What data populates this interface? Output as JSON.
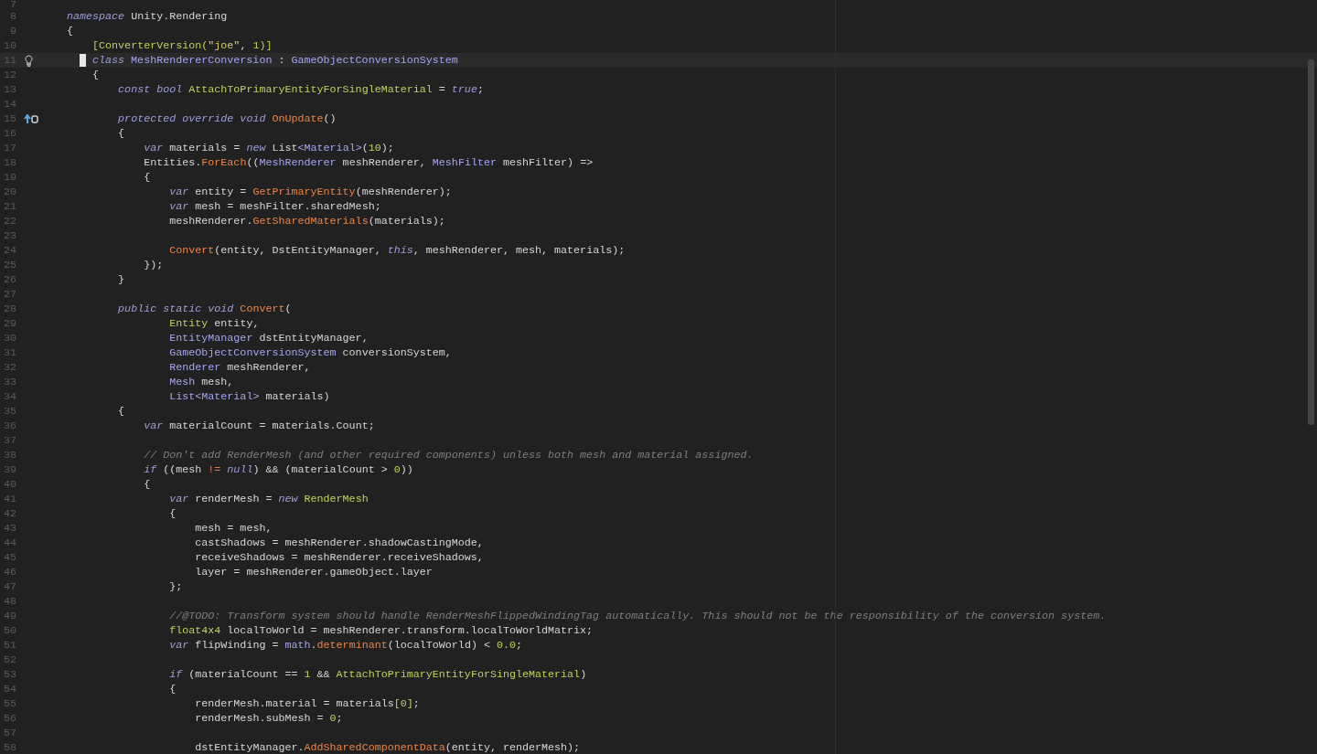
{
  "editor": {
    "lines": [
      {
        "number": "7",
        "kind": "code",
        "current": false
      },
      {
        "number": "8",
        "kind": "code",
        "current": false,
        "tokens": [
          {
            "text": "namespace",
            "kind": "kw"
          },
          {
            "text": " Unity.Rendering",
            "kind": "t"
          }
        ]
      },
      {
        "number": "9",
        "kind": "code",
        "current": false,
        "tokens": [
          {
            "text": "{",
            "kind": "t"
          }
        ]
      },
      {
        "number": "10",
        "kind": "code",
        "current": false,
        "tokens": [
          {
            "text": "    [ConverterVersion(",
            "kind": "cls"
          },
          {
            "text": "\"joe\"",
            "kind": "str"
          },
          {
            "text": ", ",
            "kind": "t"
          },
          {
            "text": "1",
            "kind": "num"
          },
          {
            "text": ")]",
            "kind": "cls"
          }
        ]
      },
      {
        "number": "11",
        "kind": "bulb",
        "current": true,
        "tokens": [
          {
            "text": " class",
            "kind": "kw"
          },
          {
            "text": " MeshRendererConversion",
            "kind": "type"
          },
          {
            "text": " : ",
            "kind": "t"
          },
          {
            "text": "GameObjectConversionSystem",
            "kind": "type"
          }
        ]
      },
      {
        "number": "12",
        "kind": "code",
        "current": false,
        "tokens": [
          {
            "text": "    {",
            "kind": "t"
          }
        ]
      },
      {
        "number": "13",
        "kind": "code",
        "current": false,
        "tokens": [
          {
            "text": "        const bool",
            "kind": "kw"
          },
          {
            "text": " AttachToPrimaryEntityForSingleMaterial",
            "kind": "cls"
          },
          {
            "text": " = ",
            "kind": "t"
          },
          {
            "text": "true",
            "kind": "kw"
          },
          {
            "text": ";",
            "kind": "t"
          }
        ]
      },
      {
        "number": "14",
        "kind": "code",
        "current": false
      },
      {
        "number": "15",
        "kind": "override",
        "current": false,
        "tokens": [
          {
            "text": "        protected override void",
            "kind": "kw"
          },
          {
            "text": " OnUpdate",
            "kind": "fn"
          },
          {
            "text": "()",
            "kind": "t"
          }
        ]
      },
      {
        "number": "16",
        "kind": "code",
        "current": false,
        "tokens": [
          {
            "text": "        {",
            "kind": "t"
          }
        ]
      },
      {
        "number": "17",
        "kind": "code",
        "current": false,
        "tokens": [
          {
            "text": "            var",
            "kind": "kw"
          },
          {
            "text": " materials = ",
            "kind": "t"
          },
          {
            "text": "new",
            "kind": "kw"
          },
          {
            "text": " List",
            "kind": "t"
          },
          {
            "text": "<Material>",
            "kind": "type"
          },
          {
            "text": "(",
            "kind": "t"
          },
          {
            "text": "10",
            "kind": "num"
          },
          {
            "text": ");",
            "kind": "t"
          }
        ]
      },
      {
        "number": "18",
        "kind": "code",
        "current": false,
        "tokens": [
          {
            "text": "            Entities.",
            "kind": "t"
          },
          {
            "text": "ForEach",
            "kind": "fn"
          },
          {
            "text": "((",
            "kind": "t"
          },
          {
            "text": "MeshRenderer",
            "kind": "type"
          },
          {
            "text": " meshRenderer, ",
            "kind": "t"
          },
          {
            "text": "MeshFilter",
            "kind": "type"
          },
          {
            "text": " meshFilter) =>",
            "kind": "t"
          }
        ]
      },
      {
        "number": "19",
        "kind": "code",
        "current": false,
        "tokens": [
          {
            "text": "            {",
            "kind": "t"
          }
        ]
      },
      {
        "number": "20",
        "kind": "code",
        "current": false,
        "tokens": [
          {
            "text": "                var",
            "kind": "kw"
          },
          {
            "text": " entity = ",
            "kind": "t"
          },
          {
            "text": "GetPrimaryEntity",
            "kind": "fn"
          },
          {
            "text": "(meshRenderer);",
            "kind": "t"
          }
        ]
      },
      {
        "number": "21",
        "kind": "code",
        "current": false,
        "tokens": [
          {
            "text": "                var",
            "kind": "kw"
          },
          {
            "text": " mesh = meshFilter.sharedMesh;",
            "kind": "t"
          }
        ]
      },
      {
        "number": "22",
        "kind": "code",
        "current": false,
        "tokens": [
          {
            "text": "                meshRenderer.",
            "kind": "t"
          },
          {
            "text": "GetSharedMaterials",
            "kind": "fn"
          },
          {
            "text": "(materials);",
            "kind": "t"
          }
        ]
      },
      {
        "number": "23",
        "kind": "code",
        "current": false
      },
      {
        "number": "24",
        "kind": "code",
        "current": false,
        "tokens": [
          {
            "text": "                Convert",
            "kind": "fn"
          },
          {
            "text": "(entity, DstEntityManager, ",
            "kind": "t"
          },
          {
            "text": "this",
            "kind": "kw"
          },
          {
            "text": ", meshRenderer, mesh, materials);",
            "kind": "t"
          }
        ]
      },
      {
        "number": "25",
        "kind": "code",
        "current": false,
        "tokens": [
          {
            "text": "            });",
            "kind": "t"
          }
        ]
      },
      {
        "number": "26",
        "kind": "code",
        "current": false,
        "tokens": [
          {
            "text": "        }",
            "kind": "t"
          }
        ]
      },
      {
        "number": "27",
        "kind": "code",
        "current": false
      },
      {
        "number": "28",
        "kind": "code",
        "current": false,
        "tokens": [
          {
            "text": "        public static void",
            "kind": "kw"
          },
          {
            "text": " Convert",
            "kind": "fn"
          },
          {
            "text": "(",
            "kind": "t"
          }
        ]
      },
      {
        "number": "29",
        "kind": "code",
        "current": false,
        "tokens": [
          {
            "text": "                Entity",
            "kind": "cls"
          },
          {
            "text": " entity,",
            "kind": "t"
          }
        ]
      },
      {
        "number": "30",
        "kind": "code",
        "current": false,
        "tokens": [
          {
            "text": "                EntityManager",
            "kind": "type"
          },
          {
            "text": " dstEntityManager,",
            "kind": "t"
          }
        ]
      },
      {
        "number": "31",
        "kind": "code",
        "current": false,
        "tokens": [
          {
            "text": "                GameObjectConversionSystem",
            "kind": "type"
          },
          {
            "text": " conversionSystem,",
            "kind": "t"
          }
        ]
      },
      {
        "number": "32",
        "kind": "code",
        "current": false,
        "tokens": [
          {
            "text": "                Renderer",
            "kind": "type"
          },
          {
            "text": " meshRenderer,",
            "kind": "t"
          }
        ]
      },
      {
        "number": "33",
        "kind": "code",
        "current": false,
        "tokens": [
          {
            "text": "                Mesh",
            "kind": "type"
          },
          {
            "text": " mesh,",
            "kind": "t"
          }
        ]
      },
      {
        "number": "34",
        "kind": "code",
        "current": false,
        "tokens": [
          {
            "text": "                List<Material>",
            "kind": "type"
          },
          {
            "text": " materials)",
            "kind": "t"
          }
        ]
      },
      {
        "number": "35",
        "kind": "code",
        "current": false,
        "tokens": [
          {
            "text": "        {",
            "kind": "t"
          }
        ]
      },
      {
        "number": "36",
        "kind": "code",
        "current": false,
        "tokens": [
          {
            "text": "            var",
            "kind": "kw"
          },
          {
            "text": " materialCount = materials.Count;",
            "kind": "t"
          }
        ]
      },
      {
        "number": "37",
        "kind": "code",
        "current": false
      },
      {
        "number": "38",
        "kind": "code",
        "current": false,
        "tokens": [
          {
            "text": "            // Don't add RenderMesh (and other required components) unless both mesh and material assigned.",
            "kind": "cm"
          }
        ]
      },
      {
        "number": "39",
        "kind": "code",
        "current": false,
        "tokens": [
          {
            "text": "            if",
            "kind": "kw"
          },
          {
            "text": " ((mesh ",
            "kind": "t"
          },
          {
            "text": "!=",
            "kind": "op"
          },
          {
            "text": " null",
            "kind": "kw"
          },
          {
            "text": ") && (materialCount > ",
            "kind": "t"
          },
          {
            "text": "0",
            "kind": "num"
          },
          {
            "text": "))",
            "kind": "t"
          }
        ]
      },
      {
        "number": "40",
        "kind": "code",
        "current": false,
        "tokens": [
          {
            "text": "            {",
            "kind": "t"
          }
        ]
      },
      {
        "number": "41",
        "kind": "code",
        "current": false,
        "tokens": [
          {
            "text": "                var",
            "kind": "kw"
          },
          {
            "text": " renderMesh = ",
            "kind": "t"
          },
          {
            "text": "new",
            "kind": "kw"
          },
          {
            "text": " RenderMesh",
            "kind": "cls"
          }
        ]
      },
      {
        "number": "42",
        "kind": "code",
        "current": false,
        "tokens": [
          {
            "text": "                {",
            "kind": "t"
          }
        ]
      },
      {
        "number": "43",
        "kind": "code",
        "current": false,
        "tokens": [
          {
            "text": "                    mesh = mesh,",
            "kind": "t"
          }
        ]
      },
      {
        "number": "44",
        "kind": "code",
        "current": false,
        "tokens": [
          {
            "text": "                    castShadows = meshRenderer.shadowCastingMode,",
            "kind": "t"
          }
        ]
      },
      {
        "number": "45",
        "kind": "code",
        "current": false,
        "tokens": [
          {
            "text": "                    receiveShadows = meshRenderer.receiveShadows,",
            "kind": "t"
          }
        ]
      },
      {
        "number": "46",
        "kind": "code",
        "current": false,
        "tokens": [
          {
            "text": "                    layer = meshRenderer.gameObject.layer",
            "kind": "t"
          }
        ]
      },
      {
        "number": "47",
        "kind": "code",
        "current": false,
        "tokens": [
          {
            "text": "                };",
            "kind": "t"
          }
        ]
      },
      {
        "number": "48",
        "kind": "code",
        "current": false
      },
      {
        "number": "49",
        "kind": "code",
        "current": false,
        "tokens": [
          {
            "text": "                //@TODO: Transform system should handle RenderMeshFlippedWindingTag automatically. This should not be the responsibility of the conversion system.",
            "kind": "cm"
          }
        ]
      },
      {
        "number": "50",
        "kind": "code",
        "current": false,
        "tokens": [
          {
            "text": "                float4x4",
            "kind": "cls"
          },
          {
            "text": " localToWorld = meshRenderer.transform.localToWorldMatrix;",
            "kind": "t"
          }
        ]
      },
      {
        "number": "51",
        "kind": "code",
        "current": false,
        "tokens": [
          {
            "text": "                var",
            "kind": "kw"
          },
          {
            "text": " flipWinding = ",
            "kind": "t"
          },
          {
            "text": "math",
            "kind": "type"
          },
          {
            "text": ".",
            "kind": "t"
          },
          {
            "text": "determinant",
            "kind": "fn"
          },
          {
            "text": "(localToWorld) < ",
            "kind": "t"
          },
          {
            "text": "0.0",
            "kind": "num"
          },
          {
            "text": ";",
            "kind": "t"
          }
        ]
      },
      {
        "number": "52",
        "kind": "code",
        "current": false
      },
      {
        "number": "53",
        "kind": "code",
        "current": false,
        "tokens": [
          {
            "text": "                if",
            "kind": "kw"
          },
          {
            "text": " (materialCount == ",
            "kind": "t"
          },
          {
            "text": "1",
            "kind": "num"
          },
          {
            "text": " && ",
            "kind": "t"
          },
          {
            "text": "AttachToPrimaryEntityForSingleMaterial",
            "kind": "cls"
          },
          {
            "text": ")",
            "kind": "t"
          }
        ]
      },
      {
        "number": "54",
        "kind": "code",
        "current": false,
        "tokens": [
          {
            "text": "                {",
            "kind": "t"
          }
        ]
      },
      {
        "number": "55",
        "kind": "code",
        "current": false,
        "tokens": [
          {
            "text": "                    renderMesh.material = materials",
            "kind": "t"
          },
          {
            "text": "[0]",
            "kind": "num"
          },
          {
            "text": ";",
            "kind": "t"
          }
        ]
      },
      {
        "number": "56",
        "kind": "code",
        "current": false,
        "tokens": [
          {
            "text": "                    renderMesh.subMesh = ",
            "kind": "t"
          },
          {
            "text": "0",
            "kind": "num"
          },
          {
            "text": ";",
            "kind": "t"
          }
        ]
      },
      {
        "number": "57",
        "kind": "code",
        "current": false
      },
      {
        "number": "58",
        "kind": "code",
        "current": false,
        "tokens": [
          {
            "text": "                    dstEntityManager.",
            "kind": "t"
          },
          {
            "text": "AddSharedComponentData",
            "kind": "fn"
          },
          {
            "text": "(entity, renderMesh);",
            "kind": "t"
          }
        ]
      }
    ]
  }
}
